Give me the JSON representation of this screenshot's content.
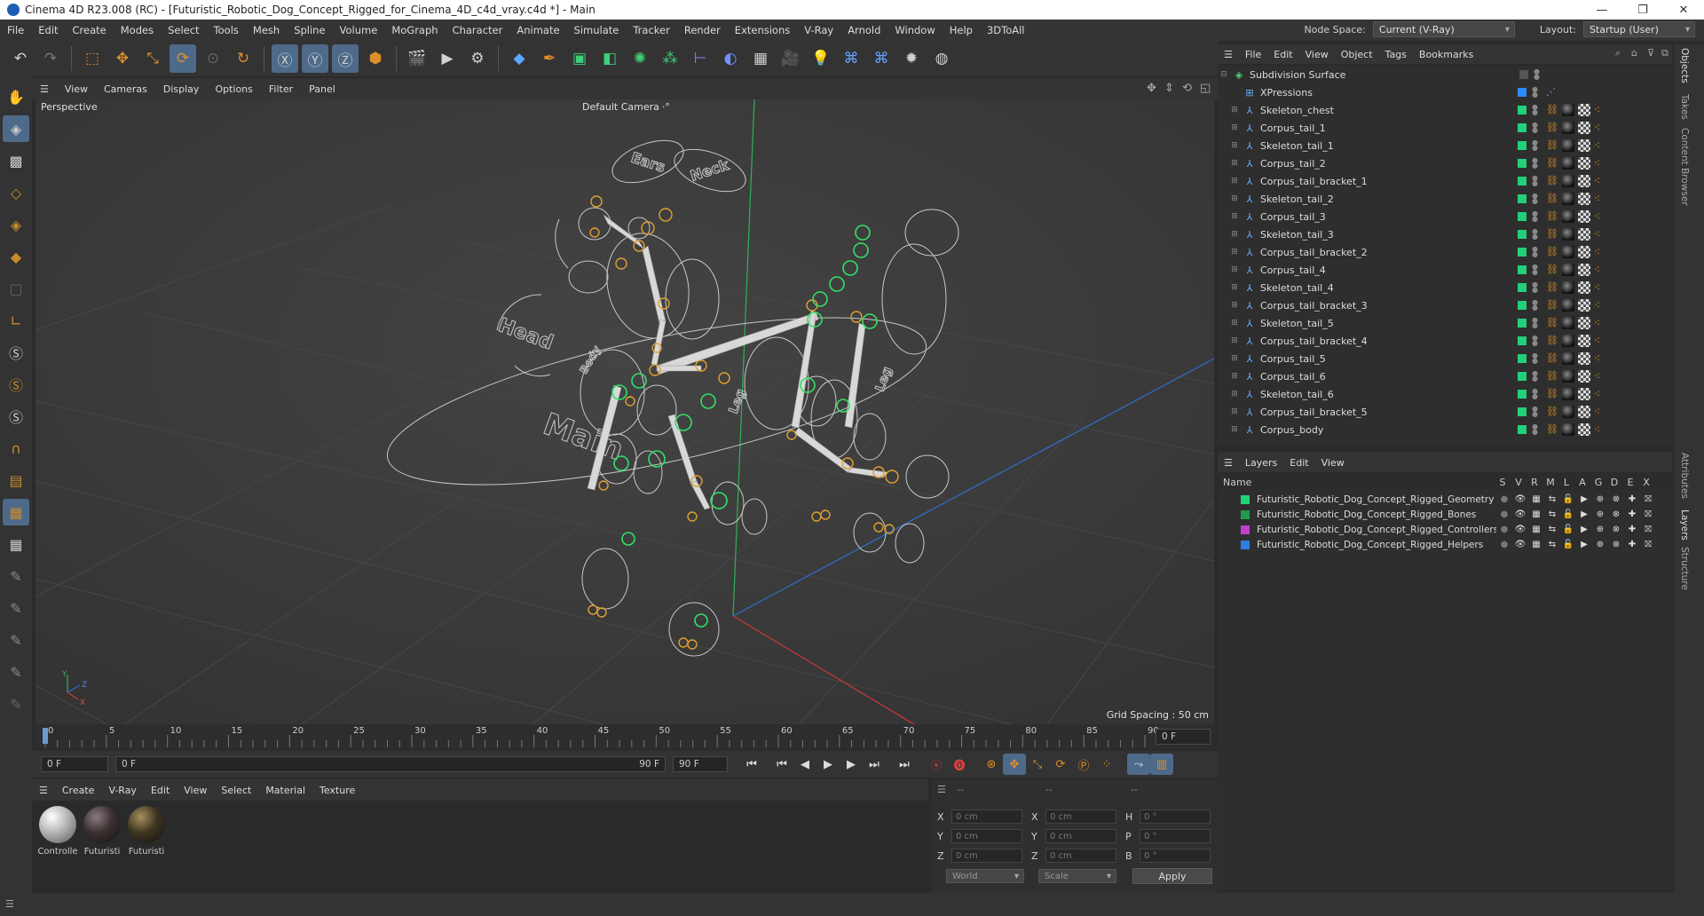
{
  "window": {
    "title": "Cinema 4D R23.008 (RC) - [Futuristic_Robotic_Dog_Concept_Rigged_for_Cinema_4D_c4d_vray.c4d *] - Main",
    "controls": [
      "—",
      "❐",
      "✕"
    ]
  },
  "menubar": {
    "items": [
      "File",
      "Edit",
      "Create",
      "Modes",
      "Select",
      "Tools",
      "Mesh",
      "Spline",
      "Volume",
      "MoGraph",
      "Character",
      "Animate",
      "Simulate",
      "Tracker",
      "Render",
      "Extensions",
      "V-Ray",
      "Arnold",
      "Window",
      "Help",
      "3DToAll"
    ],
    "node_space_label": "Node Space:",
    "node_space_value": "Current (V-Ray)",
    "layout_label": "Layout:",
    "layout_value": "Startup (User)"
  },
  "viewport": {
    "menu": [
      "View",
      "Cameras",
      "Display",
      "Options",
      "Filter",
      "Panel"
    ],
    "view_name": "Perspective",
    "camera": "Default Camera",
    "camera_suffix": "·°",
    "grid_spacing": "Grid Spacing : 50 cm",
    "model_labels": [
      "Ears",
      "Neck",
      "Head",
      "Main",
      "Leg",
      "Leg",
      "Body"
    ]
  },
  "timeline": {
    "ticks": [
      "0",
      "5",
      "10",
      "15",
      "20",
      "25",
      "30",
      "35",
      "40",
      "45",
      "50",
      "55",
      "60",
      "65",
      "70",
      "75",
      "80",
      "85",
      "90"
    ],
    "current_frame": "0 F",
    "start_field": "0 F",
    "range_start": "0 F",
    "range_end": "90 F",
    "end_field": "90 F"
  },
  "materials": {
    "menu": [
      "Create",
      "V-Ray",
      "Edit",
      "View",
      "Select",
      "Material",
      "Texture"
    ],
    "items": [
      {
        "name": "Controlle",
        "color": "#bcbcbc"
      },
      {
        "name": "Futuristi",
        "color": "#3a3030"
      },
      {
        "name": "Futuristi",
        "color": "#3d3520"
      }
    ]
  },
  "coordinates": {
    "header": [
      "--",
      "--",
      "--"
    ],
    "rows": [
      {
        "a": "X",
        "av": "0 cm",
        "b": "X",
        "bv": "0 cm",
        "c": "H",
        "cv": "0 °"
      },
      {
        "a": "Y",
        "av": "0 cm",
        "b": "Y",
        "bv": "0 cm",
        "c": "P",
        "cv": "0 °"
      },
      {
        "a": "Z",
        "av": "0 cm",
        "b": "Z",
        "bv": "0 cm",
        "c": "B",
        "cv": "0 °"
      }
    ],
    "mode": "World",
    "scale": "Scale",
    "apply": "Apply"
  },
  "objects": {
    "menu": [
      "File",
      "Edit",
      "View",
      "Object",
      "Tags",
      "Bookmarks"
    ],
    "items": [
      {
        "name": "Subdivision Surface",
        "swatch": "",
        "icon": "subdivision-icon"
      },
      {
        "name": "XPressions",
        "swatch": "#2b8cff",
        "icon": "xpresso-icon"
      },
      {
        "name": "Skeleton_chest",
        "swatch": "#22d07a",
        "icon": "joint-icon"
      },
      {
        "name": "Corpus_tail_1",
        "swatch": "#22d07a",
        "icon": "joint-icon"
      },
      {
        "name": "Skeleton_tail_1",
        "swatch": "#22d07a",
        "icon": "joint-icon"
      },
      {
        "name": "Corpus_tail_2",
        "swatch": "#22d07a",
        "icon": "joint-icon"
      },
      {
        "name": "Corpus_tail_bracket_1",
        "swatch": "#22d07a",
        "icon": "joint-icon"
      },
      {
        "name": "Skeleton_tail_2",
        "swatch": "#22d07a",
        "icon": "joint-icon"
      },
      {
        "name": "Corpus_tail_3",
        "swatch": "#22d07a",
        "icon": "joint-icon"
      },
      {
        "name": "Skeleton_tail_3",
        "swatch": "#22d07a",
        "icon": "joint-icon"
      },
      {
        "name": "Corpus_tail_bracket_2",
        "swatch": "#22d07a",
        "icon": "joint-icon"
      },
      {
        "name": "Corpus_tail_4",
        "swatch": "#22d07a",
        "icon": "joint-icon"
      },
      {
        "name": "Skeleton_tail_4",
        "swatch": "#22d07a",
        "icon": "joint-icon"
      },
      {
        "name": "Corpus_tail_bracket_3",
        "swatch": "#22d07a",
        "icon": "joint-icon"
      },
      {
        "name": "Skeleton_tail_5",
        "swatch": "#22d07a",
        "icon": "joint-icon"
      },
      {
        "name": "Corpus_tail_bracket_4",
        "swatch": "#22d07a",
        "icon": "joint-icon"
      },
      {
        "name": "Corpus_tail_5",
        "swatch": "#22d07a",
        "icon": "joint-icon"
      },
      {
        "name": "Corpus_tail_6",
        "swatch": "#22d07a",
        "icon": "joint-icon"
      },
      {
        "name": "Skeleton_tail_6",
        "swatch": "#22d07a",
        "icon": "joint-icon"
      },
      {
        "name": "Corpus_tail_bracket_5",
        "swatch": "#22d07a",
        "icon": "joint-icon"
      },
      {
        "name": "Corpus_body",
        "swatch": "#22d07a",
        "icon": "joint-icon"
      }
    ]
  },
  "layers": {
    "menu": [
      "Layers",
      "Edit",
      "View"
    ],
    "columns": [
      "Name",
      "S",
      "V",
      "R",
      "M",
      "L",
      "A",
      "G",
      "D",
      "E",
      "X"
    ],
    "items": [
      {
        "name": "Futuristic_Robotic_Dog_Concept_Rigged_Geometry",
        "color": "#22d07a"
      },
      {
        "name": "Futuristic_Robotic_Dog_Concept_Rigged_Bones",
        "color": "#1f9a4a"
      },
      {
        "name": "Futuristic_Robotic_Dog_Concept_Rigged_Controllers",
        "color": "#c040c8"
      },
      {
        "name": "Futuristic_Robotic_Dog_Concept_Rigged_Helpers",
        "color": "#2b7fe0"
      }
    ]
  },
  "right_tabs": [
    "Objects",
    "Takes",
    "Content Browser",
    "Attributes",
    "Layers",
    "Structure"
  ],
  "colors": {
    "accent": "#4e6a8a",
    "joint_green": "#22d07a",
    "controller_orange": "#e0a030"
  }
}
